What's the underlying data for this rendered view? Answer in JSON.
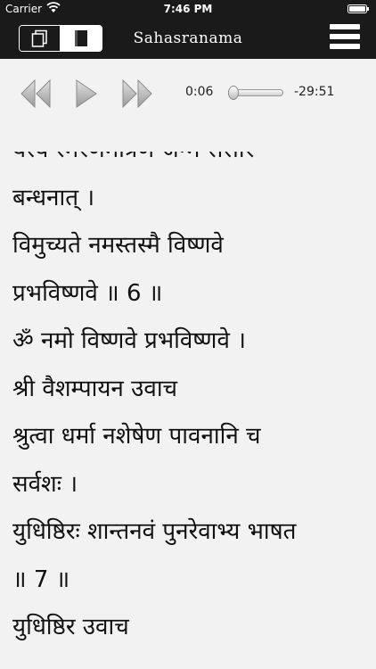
{
  "status_bar": {
    "carrier": "Carrier",
    "time": "7:46 PM"
  },
  "nav": {
    "title": "Sahasranama",
    "view_toggle": {
      "left_icon": "pages-icon",
      "right_icon": "book-icon",
      "selected": "right"
    },
    "menu_icon": "hamburger-menu-icon"
  },
  "player": {
    "current_time": "0:06",
    "remaining_time": "-29:51",
    "progress": 0.003,
    "icons": [
      "rewind-icon",
      "play-icon",
      "fast-forward-icon"
    ]
  },
  "content": {
    "lines": [
      "यस्य स्मरणमात्रेण जन्म संसार",
      "बन्धनात् ।",
      "विमुच्यते नमस्तस्मै विष्णवे",
      "प्रभविष्णवे ॥ 6 ॥",
      "ॐ नमो विष्णवे प्रभविष्णवे ।",
      "श्री वैशम्पायन उवाच",
      "श्रुत्वा धर्मा नशेषेण पावनानि च",
      "सर्वशः ।",
      "युधिष्ठिरः शान्तनवं पुनरेवाभ्य भाषत",
      "॥ 7 ॥",
      "युधिष्ठिर उवाच"
    ]
  },
  "colors": {
    "navbar_bg": "#1a1a1a",
    "content_bg": "#f2f2f2",
    "text": "#111111"
  }
}
